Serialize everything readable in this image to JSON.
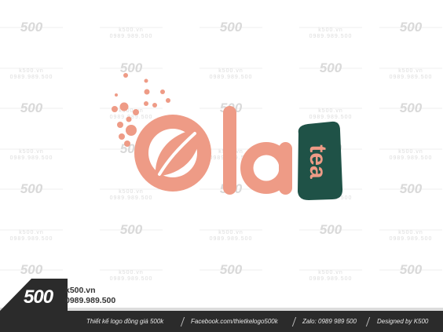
{
  "watermark": {
    "brand": "500",
    "site": "k500.vn",
    "phone": "0989.989.500"
  },
  "logo": {
    "word": "Ola",
    "badge_text": "tea",
    "colors": {
      "peach": "#ee9b86",
      "badge_green": "#1f5247",
      "badge_text": "#ee9b86"
    },
    "icon": "leaf-bubbles-icon"
  },
  "footer": {
    "brand_number": "500",
    "site": "k500.vn",
    "phone": "0989.989.500",
    "items": [
      "Thiết kế logo đồng giá 500k",
      "Facebook.com/thietkelogo500k",
      "Zalo: 0989 989 500",
      "Designed by K500"
    ],
    "colors": {
      "bar": "#2b2b2b",
      "text": "#e8e8e8"
    }
  }
}
